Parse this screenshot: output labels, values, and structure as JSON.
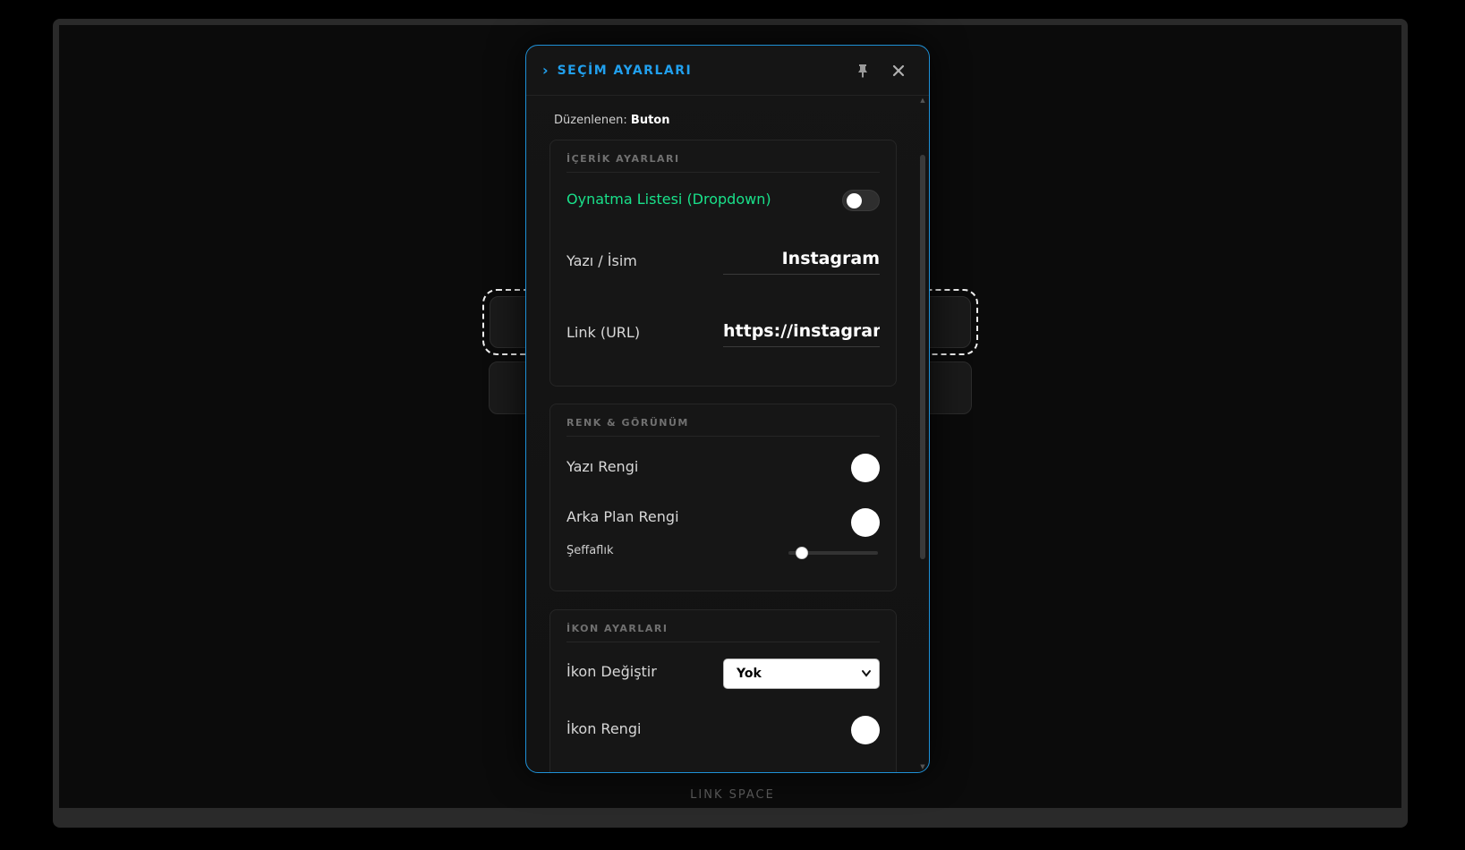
{
  "page": {
    "footer_label": "LINK SPACE"
  },
  "panel": {
    "title": "SEÇİM AYARLARI",
    "chevron": "›",
    "pin_icon": "pin-icon",
    "close_icon": "close-icon",
    "edited_label": "Düzenlenen:",
    "edited_value": "Buton",
    "accent_color": "#1e90d6"
  },
  "content_section": {
    "title": "İÇERİK AYARLARI",
    "playlist_toggle_label": "Oynatma Listesi (Dropdown)",
    "playlist_toggle_on": false,
    "name_label": "Yazı / İsim",
    "name_value": "Instagram",
    "url_label": "Link (URL)",
    "url_value": "https://instagram.com"
  },
  "appearance_section": {
    "title": "RENK & GÖRÜNÜM",
    "text_color_label": "Yazı Rengi",
    "text_color": "#ffffff",
    "bg_color_label": "Arka Plan Rengi",
    "bg_color": "#ffffff",
    "opacity_label": "Şeffaflık",
    "opacity_value": 0.12
  },
  "icon_section": {
    "title": "İKON AYARLARI",
    "icon_change_label": "İkon Değiştir",
    "icon_selected": "Yok",
    "icon_color_label": "İkon Rengi",
    "icon_color": "#ffffff"
  }
}
